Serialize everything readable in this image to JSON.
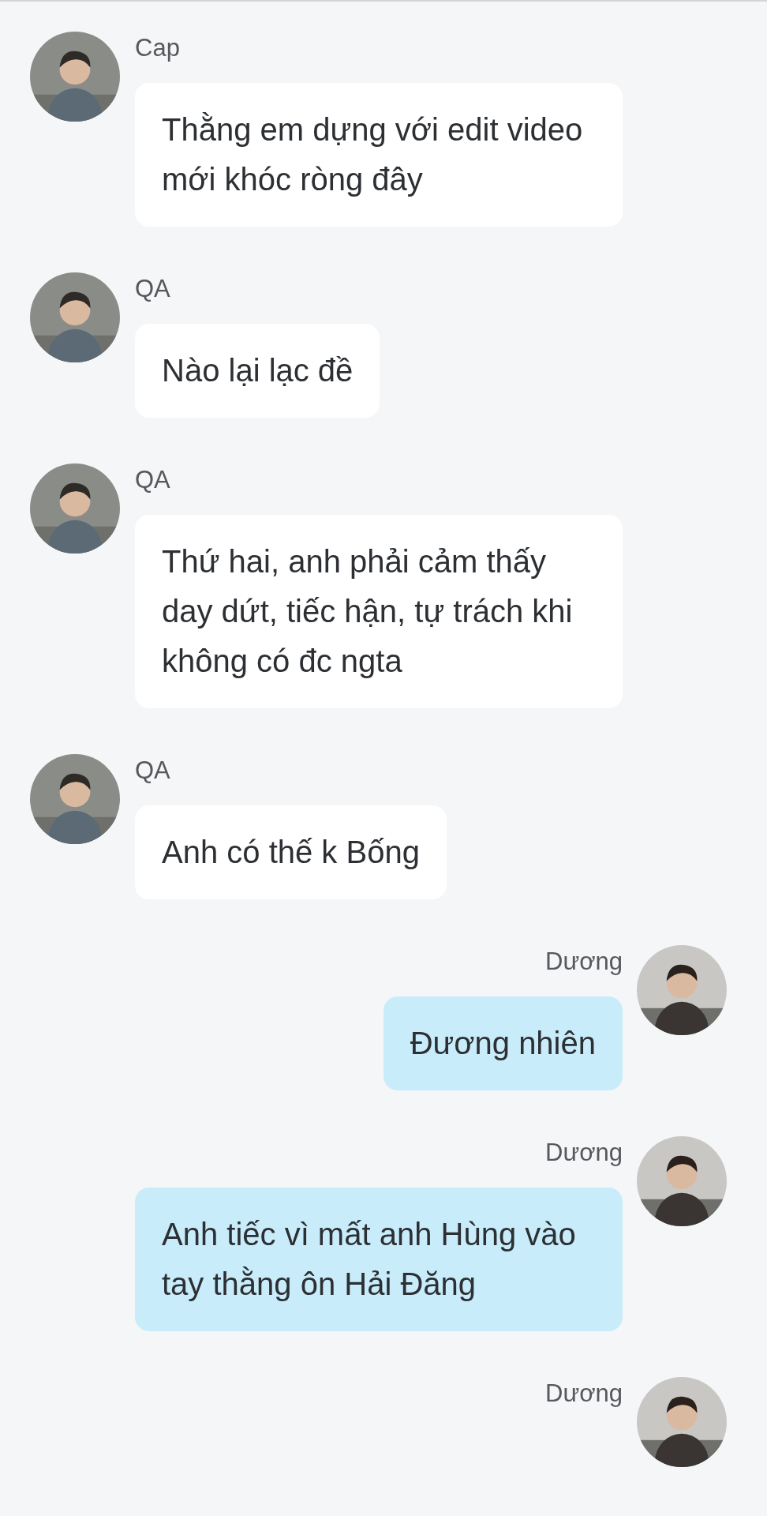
{
  "messages": [
    {
      "kind": "incoming",
      "sender": "Cap",
      "text": "Thằng em dựng với edit video mới khóc ròng đây"
    },
    {
      "kind": "incoming",
      "sender": "QA",
      "text": "Nào lại lạc đề"
    },
    {
      "kind": "incoming",
      "sender": "QA",
      "text": "Thứ hai, anh phải cảm thấy day dứt, tiếc hận, tự trách khi không có đc ngta"
    },
    {
      "kind": "incoming",
      "sender": "QA",
      "text": "Anh có thế k Bống"
    },
    {
      "kind": "outgoing",
      "sender": "Dương",
      "text": "Đương nhiên"
    },
    {
      "kind": "outgoing",
      "sender": "Dương",
      "text": "Anh tiếc vì mất anh Hùng vào tay thằng ôn Hải Đăng"
    },
    {
      "kind": "outgoing",
      "sender": "Dương"
    }
  ]
}
